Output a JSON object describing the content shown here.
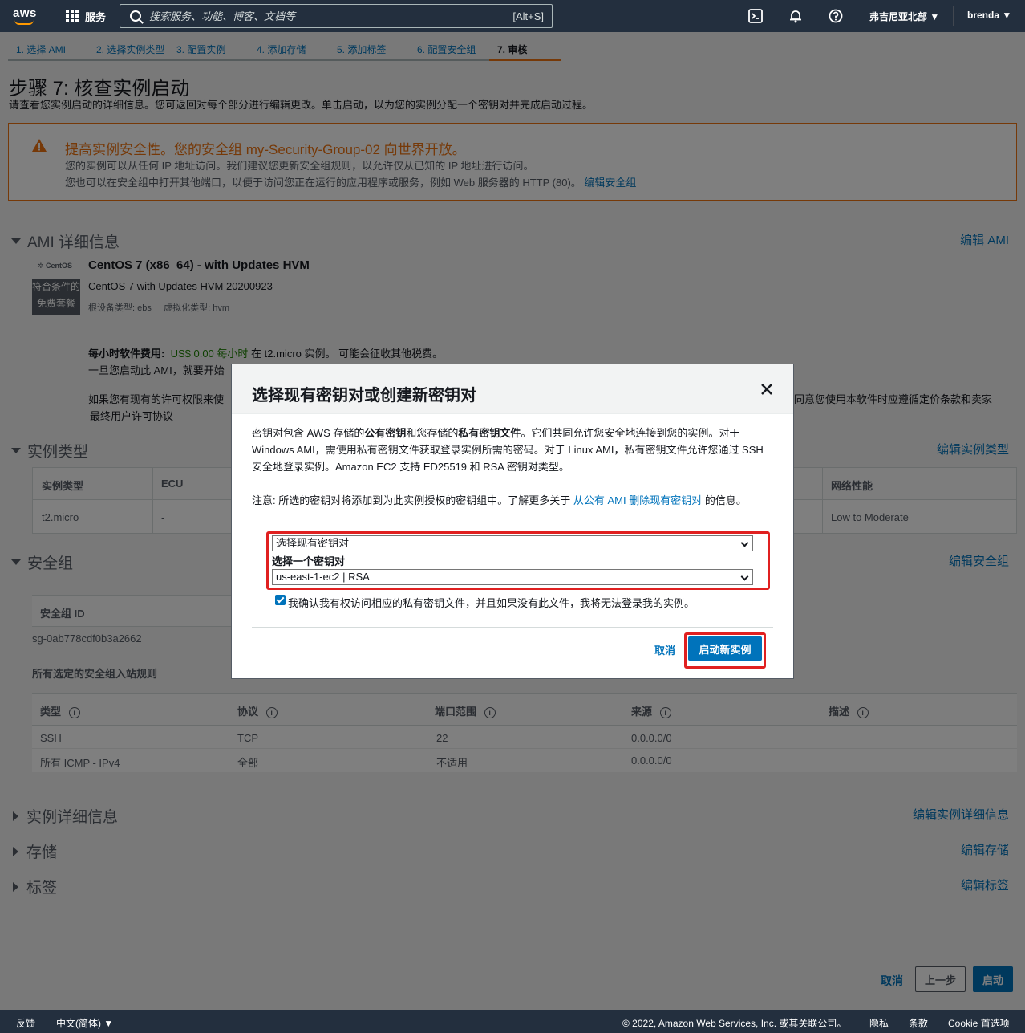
{
  "nav": {
    "logo": "aws",
    "services": "服务",
    "search_placeholder": "搜索服务、功能、博客、文档等",
    "search_shortcut": "[Alt+S]",
    "region": "弗吉尼亚北部 ▼",
    "user": "brenda ▼"
  },
  "tabs": [
    "1. 选择 AMI",
    "2. 选择实例类型",
    "3. 配置实例",
    "4. 添加存储",
    "5. 添加标签",
    "6. 配置安全组",
    "7. 审核"
  ],
  "page": {
    "title": "步骤 7: 核查实例启动",
    "desc": "请查看您实例启动的详细信息。您可返回对每个部分进行编辑更改。单击启动，以为您的实例分配一个密钥对并完成启动过程。"
  },
  "warning": {
    "title": "提高实例安全性。您的安全组 my-Security-Group-02 向世界开放。",
    "line1": "您的实例可以从任何 IP 地址访问。我们建议您更新安全组规则，以允许仅从已知的 IP 地址进行访问。",
    "line2": "您也可以在安全组中打开其他端口，以便于访问您正在运行的应用程序或服务，例如 Web 服务器的 HTTP (80)。",
    "link": "编辑安全组"
  },
  "ami": {
    "section": "AMI 详细信息",
    "edit": "编辑 AMI",
    "logo": "CentOS",
    "badge_l1": "符合条件的",
    "badge_l2": "免费套餐",
    "name": "CentOS 7 (x86_64) - with Updates HVM",
    "sub": "CentOS 7 with Updates HVM 20200923",
    "root": "根设备类型: ebs",
    "virt": "虚拟化类型: hvm",
    "fee_label": "每小时软件费用:",
    "fee_value": "US$ 0.00 每小时",
    "fee_rest": "在 t2.micro 实例。 可能会征收其他税费。",
    "line2": "一旦您启动此 AMI，就要开始",
    "line3_left": "如果您有现有的许可权限来使",
    "line3_right": "同意您使用本软件时应遵循定价条款和卖家",
    "eula": "最终用户许可协议"
  },
  "instance_type": {
    "section": "实例类型",
    "edit": "编辑实例类型",
    "headers": [
      "实例类型",
      "ECU",
      "网络性能"
    ],
    "row": [
      "t2.micro",
      "-",
      "Low to Moderate"
    ]
  },
  "security_group": {
    "section": "安全组",
    "edit": "编辑安全组",
    "id_header": "安全组 ID",
    "id": "sg-0ab778cdf0b3a2662",
    "rules_title": "所有选定的安全组入站规则",
    "headers": [
      "类型",
      "协议",
      "端口范围",
      "来源",
      "描述"
    ],
    "rows": [
      [
        "SSH",
        "TCP",
        "22",
        "0.0.0.0/0",
        ""
      ],
      [
        "所有 ICMP - IPv4",
        "全部",
        "不适用",
        "0.0.0.0/0",
        ""
      ]
    ]
  },
  "collapsed": [
    {
      "title": "实例详细信息",
      "edit": "编辑实例详细信息"
    },
    {
      "title": "存储",
      "edit": "编辑存储"
    },
    {
      "title": "标签",
      "edit": "编辑标签"
    }
  ],
  "bottom": {
    "cancel": "取消",
    "prev": "上一步",
    "launch": "启动"
  },
  "modal": {
    "title": "选择现有密钥对或创建新密钥对",
    "p1_a": "密钥对包含 AWS 存储的",
    "p1_b": "公有密钥",
    "p1_c": "和您存储的",
    "p1_d": "私有密钥文件",
    "p1_e": "。它们共同允许您安全地连接到您的实例。对于 Windows AMI，需使用私有密钥文件获取登录实例所需的密码。对于 Linux AMI，私有密钥文件允许您通过 SSH 安全地登录实例。Amazon EC2 支持 ED25519 和 RSA 密钥对类型。",
    "note_a": "注意: 所选的密钥对将添加到为此实例授权的密钥组中。了解更多关于",
    "note_link": "从公有 AMI 删除现有密钥对",
    "note_b": "的信息。",
    "select1": "选择现有密钥对",
    "select_label": "选择一个密钥对",
    "select2": "us-east-1-ec2 | RSA",
    "ack": "我确认我有权访问相应的私有密钥文件，并且如果没有此文件，我将无法登录我的实例。",
    "cancel": "取消",
    "launch": "启动新实例"
  },
  "footer": {
    "feedback": "反馈",
    "lang": "中文(简体) ▼",
    "copyright": "© 2022, Amazon Web Services, Inc. 或其关联公司。",
    "privacy": "隐私",
    "terms": "条款",
    "cookie": "Cookie 首选项"
  }
}
